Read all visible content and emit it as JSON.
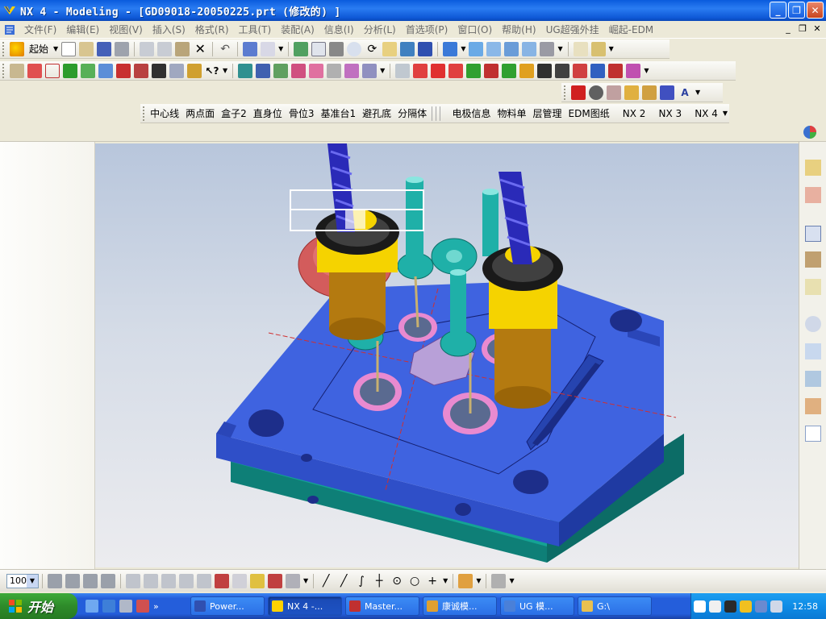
{
  "window": {
    "title": "NX 4 - Modeling - [GD09018-20050225.prt  (修改的) ]",
    "controls": [
      "minimize",
      "maximize",
      "close"
    ]
  },
  "menu": {
    "items": [
      "文件(F)",
      "编辑(E)",
      "视图(V)",
      "插入(S)",
      "格式(R)",
      "工具(T)",
      "装配(A)",
      "信息(I)",
      "分析(L)",
      "首选项(P)",
      "窗口(O)",
      "帮助(H)",
      "UG超强外挂",
      "崛起-EDM"
    ]
  },
  "toolbar": {
    "start_label": "起始",
    "plugin_labels": [
      "中心线",
      "两点面",
      "盒子2",
      "直身位",
      "骨位3",
      "基准台1",
      "避孔底",
      "分隔体"
    ],
    "plugin_labels2": [
      "电极信息",
      "物料单",
      "层管理",
      "EDM图纸",
      "NX 2",
      "NX 3",
      "NX 4"
    ]
  },
  "bottom": {
    "zoom_value": "100"
  },
  "taskbar": {
    "start_label": "开始",
    "tasks": [
      "Power...",
      "NX 4 -...",
      "Master...",
      "康诚模...",
      "UG 模...",
      "G:\\"
    ],
    "clock": "12:58"
  },
  "colors": {
    "plate_blue": "#3f63e0",
    "plate_teal": "#0f8a80",
    "gear_pink": "#d35c5c",
    "gear_teal": "#1fb0a8",
    "screw_blue": "#2a2ab8",
    "cylinder_yellow": "#f5d300",
    "cylinder_brown": "#b47a10",
    "pink_ring": "#e98ad0"
  }
}
